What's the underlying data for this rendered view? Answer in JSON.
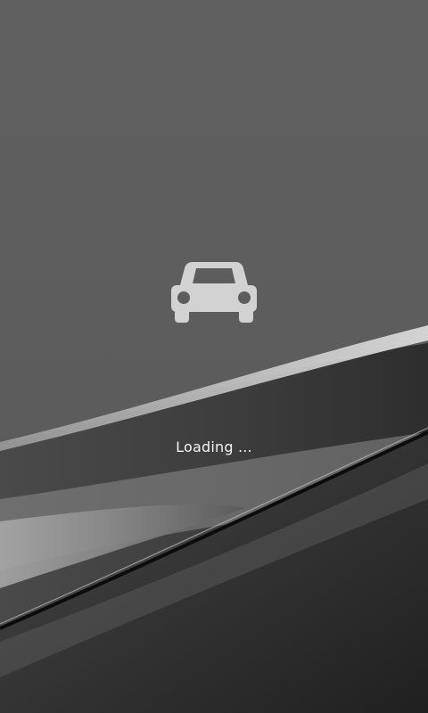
{
  "splash": {
    "icon": "car-icon",
    "loading_text": "Loading ..."
  },
  "colors": {
    "background_top": "#5f5f5f",
    "background_bottom": "#2a2a2a",
    "icon": "#d2d2d2",
    "text": "#f2f2f2"
  }
}
